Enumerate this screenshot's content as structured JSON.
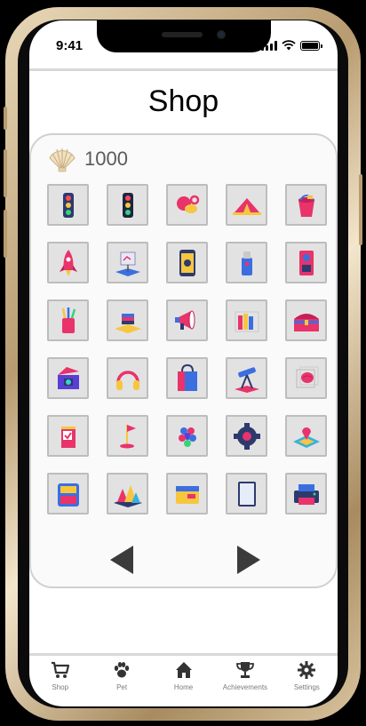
{
  "status_bar": {
    "time": "9:41"
  },
  "page": {
    "title": "Shop"
  },
  "wallet": {
    "icon": "seashell-icon",
    "coins": "1000"
  },
  "shop_items": [
    [
      "traffic-light",
      "traffic-light",
      "pacifier",
      "tent",
      "bucket"
    ],
    [
      "rocket",
      "easel-board",
      "smartphone",
      "usb-drive",
      "robot"
    ],
    [
      "pencil-cup",
      "books",
      "megaphone",
      "file-folders",
      "treasure-chest"
    ],
    [
      "gift-box",
      "headphones",
      "shopping-bag",
      "telescope",
      "brain-cube"
    ],
    [
      "juice-box",
      "golf-flag",
      "grapes",
      "gear",
      "map-pin"
    ],
    [
      "arcade-machine",
      "mountains",
      "wallet",
      "tablet",
      "printer"
    ]
  ],
  "pagination": {
    "prev_icon": "triangle-left-icon",
    "next_icon": "triangle-right-icon"
  },
  "tabs": [
    {
      "label": "Shop",
      "icon": "cart-icon"
    },
    {
      "label": "Pet",
      "icon": "paw-icon"
    },
    {
      "label": "Home",
      "icon": "home-icon"
    },
    {
      "label": "Achievements",
      "icon": "trophy-icon"
    },
    {
      "label": "Settings",
      "icon": "gear-icon"
    }
  ],
  "colors": {
    "accent_pink": "#e8336b",
    "accent_blue": "#3b6fe0",
    "accent_yellow": "#f6c63f",
    "tab_icon": "#333333",
    "tab_label": "#7a7a7a"
  }
}
